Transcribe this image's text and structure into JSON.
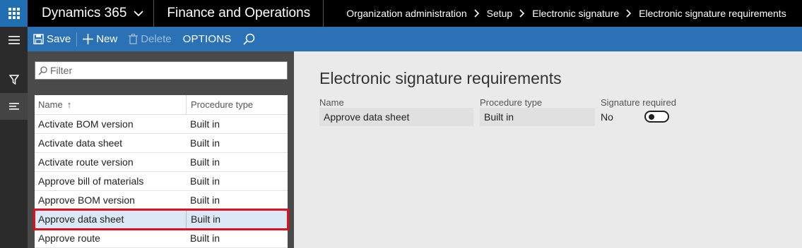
{
  "header": {
    "brand": "Dynamics 365",
    "app_title": "Finance and Operations",
    "breadcrumb": [
      "Organization administration",
      "Setup",
      "Electronic signature",
      "Electronic signature requirements"
    ]
  },
  "toolbar": {
    "save_label": "Save",
    "new_label": "New",
    "delete_label": "Delete",
    "options_label": "OPTIONS"
  },
  "list": {
    "filter_placeholder": "Filter",
    "columns": {
      "name": "Name",
      "procedure_type": "Procedure type"
    },
    "sort_indicator": "↑",
    "rows": [
      {
        "name": "Activate BOM version",
        "type": "Built in"
      },
      {
        "name": "Activate data sheet",
        "type": "Built in"
      },
      {
        "name": "Activate route version",
        "type": "Built in"
      },
      {
        "name": "Approve bill of materials",
        "type": "Built in"
      },
      {
        "name": "Approve BOM version",
        "type": "Built in"
      },
      {
        "name": "Approve data sheet",
        "type": "Built in"
      },
      {
        "name": "Approve route",
        "type": "Built in"
      }
    ]
  },
  "details": {
    "title": "Electronic signature requirements",
    "name_label": "Name",
    "name_value": "Approve data sheet",
    "type_label": "Procedure type",
    "type_value": "Built in",
    "sig_label": "Signature required",
    "sig_value": "No"
  },
  "colors": {
    "header_bg": "#000000",
    "waffle_bg": "#1f6fb2",
    "actionbar_bg": "#2a72b5",
    "highlight": "#e0101e"
  }
}
